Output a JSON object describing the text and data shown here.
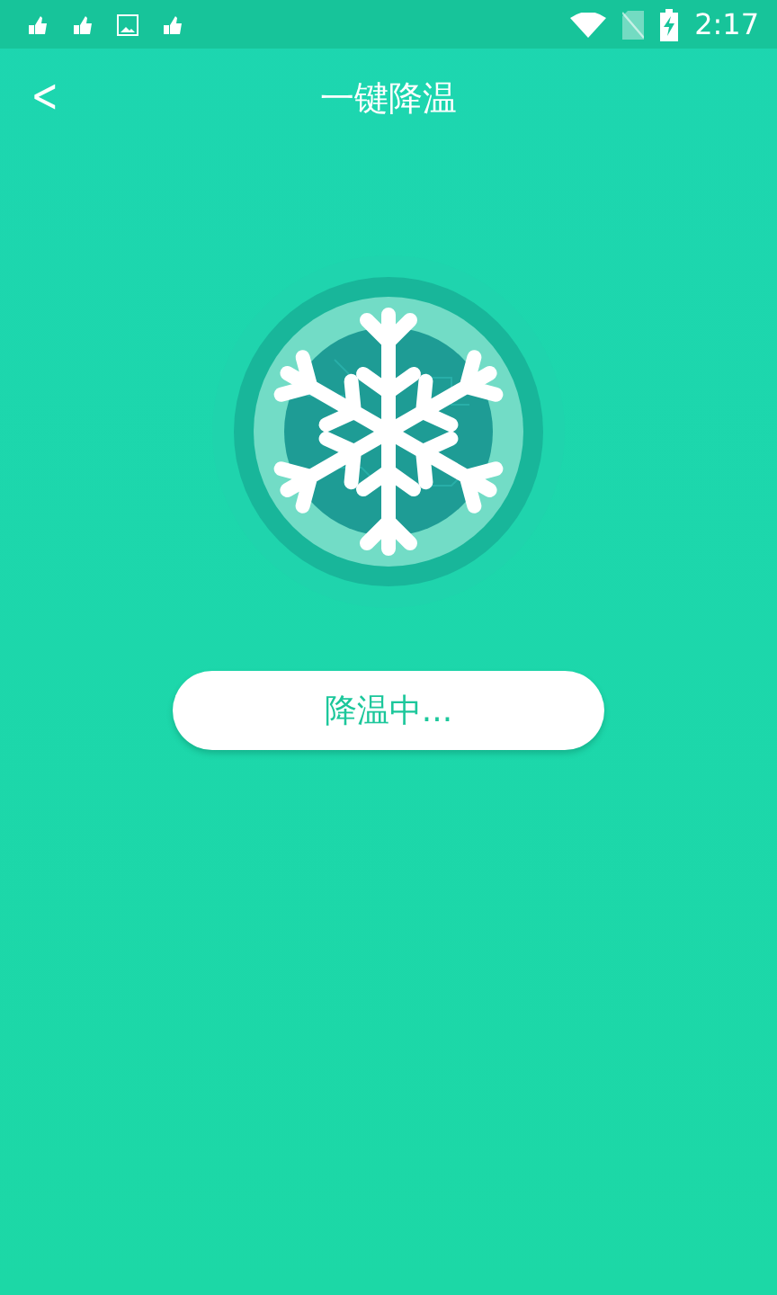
{
  "status_bar": {
    "time": "2:17"
  },
  "header": {
    "back": "<",
    "title": "一键降温"
  },
  "action": {
    "label": "降温中..."
  }
}
